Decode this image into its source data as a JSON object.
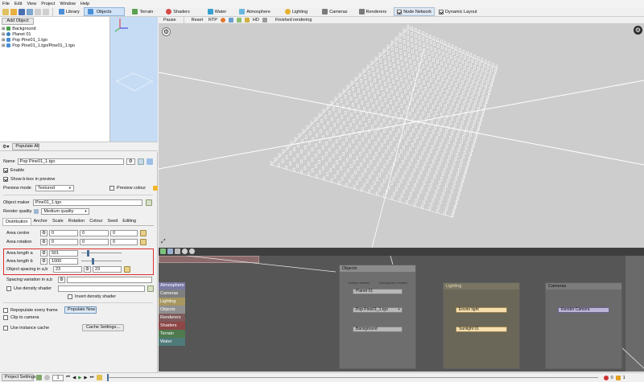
{
  "menu": [
    "File",
    "Edit",
    "View",
    "Project",
    "Window",
    "Help"
  ],
  "top_tabs": [
    {
      "label": "Library",
      "color": "#4a8fd6",
      "active": false
    },
    {
      "label": "Objects",
      "color": "#4a8fd6",
      "active": true
    },
    {
      "label": "Terrain",
      "color": "#5aa24f",
      "active": false
    },
    {
      "label": "Shaders",
      "color": "#d64a4a",
      "active": false
    },
    {
      "label": "Water",
      "color": "#3aa0d0",
      "active": false
    },
    {
      "label": "Atmosphere",
      "color": "#3aa0d0",
      "active": false
    },
    {
      "label": "Lighting",
      "color": "#e6b030",
      "active": false
    },
    {
      "label": "Cameras",
      "color": "#7a7a7a",
      "active": false
    },
    {
      "label": "Renderers",
      "color": "#7a7a7a",
      "active": false
    },
    {
      "label": "Node Network",
      "color": "#6a6a9a",
      "active": true
    },
    {
      "label": "Dynamic Layout",
      "color": "#7a7a7a",
      "active": true
    }
  ],
  "render_toolbar": {
    "pause": "Pause",
    "reset": "Reset",
    "rtp": "RTP",
    "hd": "HD",
    "status": "Finished rendering"
  },
  "left_panel": {
    "add_object": "Add Object",
    "tree": [
      {
        "label": "Background",
        "color": "#4aa04a"
      },
      {
        "label": "Planet 01",
        "color": "#3a80c0"
      },
      {
        "label": "Pop Pine01_1.tgo",
        "color": "#4a8fd6"
      },
      {
        "label": "Pop Pine01_1.tgo/Pine01_1.tgo",
        "color": "#4a8fd6"
      }
    ],
    "populate_all": "Populate All"
  },
  "props": {
    "name_label": "Name",
    "name_value": "Pop Pine01_1.tgo",
    "enable": "Enable",
    "show_bbox": "Show b-box in preview",
    "preview_mode_label": "Preview mode",
    "preview_mode_value": "Textured",
    "preview_colour": "Preview colour",
    "object_maker_label": "Object maker",
    "object_maker_value": "Pine01_1.tgo",
    "render_quality_label": "Render quality",
    "render_quality_value": "Medium quality",
    "tabs": [
      "Distribution",
      "Anchor",
      "Scale",
      "Rotation",
      "Colour",
      "Seed",
      "Editing"
    ],
    "area_centre_label": "Area centre",
    "area_centre": [
      "0",
      "0",
      "0"
    ],
    "area_rotation_label": "Area rotation",
    "area_rotation": [
      "0",
      "0",
      "0"
    ],
    "area_length_a_label": "Area length a",
    "area_length_a": "501",
    "area_length_a_level": 0.14,
    "area_length_b_label": "Area length b",
    "area_length_b": "1000",
    "area_length_b_level": 0.28,
    "spacing_label": "Object spacing in a,b",
    "spacing": [
      "23",
      "23"
    ],
    "spacing_variation_label": "Spacing variation in a,b",
    "use_density_shader": "Use density shader",
    "invert_density_shader": "Invert density shader",
    "repopulate": "Repopulate every frame",
    "populate_now": "Populate Now",
    "clip_to_camera": "Clip to camera",
    "use_instance_cache": "Use instance cache",
    "cache_settings": "Cache Settings..."
  },
  "node_network": {
    "categories": [
      {
        "label": "Atmosphere",
        "color": "#7a79a6"
      },
      {
        "label": "Cameras",
        "color": "#8b8b8b"
      },
      {
        "label": "Lighting",
        "color": "#b6a46a"
      },
      {
        "label": "Objects",
        "color": "#9a9a9a"
      },
      {
        "label": "Renderers",
        "color": "#8a6a6a"
      },
      {
        "label": "Shaders",
        "color": "#9c5050"
      },
      {
        "label": "Terrain",
        "color": "#5a8a5a"
      },
      {
        "label": "Water",
        "color": "#5a8a8a"
      }
    ],
    "groups": {
      "objects": "Objects",
      "lighting": "Lighting",
      "cameras": "Cameras"
    },
    "ports": {
      "surface": "Surface shader",
      "atmosphere": "Atmosphere shader"
    },
    "nodes": {
      "planet": "Planet 01",
      "pop": "Pop Pine01_1.tgo",
      "background": "Background",
      "enviro": "Enviro light",
      "sunlight": "Sunlight 01",
      "camera": "Render Camera"
    }
  },
  "bottom_bar": {
    "project_settings": "Project Settings...",
    "frame": "1",
    "errors": "0",
    "warnings": "1"
  }
}
